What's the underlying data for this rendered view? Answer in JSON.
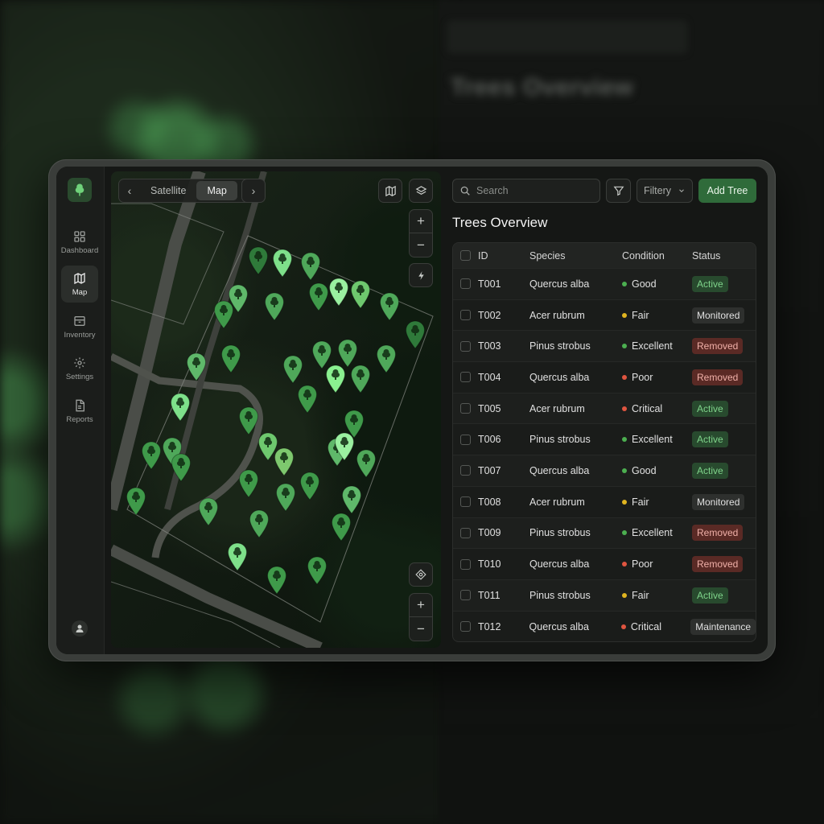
{
  "colors": {
    "accent": "#2f6b3a",
    "good": "#4caf50",
    "fair": "#e0b420",
    "poor": "#e05540",
    "badge_active_bg": "#284a2e",
    "badge_active_fg": "#7ed38a",
    "badge_removed_bg": "#5a2a25",
    "badge_removed_fg": "#f0b0a8",
    "badge_neutral_bg": "#2e302e",
    "badge_neutral_fg": "#e0e0e0"
  },
  "background": {
    "title": "Trees Overview"
  },
  "sidebar": {
    "logo_icon": "tree-icon",
    "items": [
      {
        "label": "Dashboard",
        "icon": "grid-icon",
        "active": false
      },
      {
        "label": "Map",
        "icon": "map-icon",
        "active": true
      },
      {
        "label": "Inventory",
        "icon": "box-icon",
        "active": false
      },
      {
        "label": "Settings",
        "icon": "gear-icon",
        "active": false
      },
      {
        "label": "Reports",
        "icon": "document-icon",
        "active": false
      }
    ],
    "user_icon": "user-icon"
  },
  "map": {
    "view_tabs": [
      "Satellite",
      "Map"
    ],
    "selected_view": "Map",
    "prev_label": "‹",
    "next_label": "›",
    "zoom_in": "+",
    "zoom_out": "−"
  },
  "panel": {
    "search_placeholder": "Search",
    "filter_label": "Filtery",
    "add_label": "Add Tree",
    "title": "Trees Overview",
    "columns": [
      "ID",
      "Species",
      "Condition",
      "Status"
    ],
    "rows": [
      {
        "id": "T001",
        "species": "Quercus alba",
        "condition": "Good",
        "status": "Active"
      },
      {
        "id": "T002",
        "species": "Acer rubrum",
        "condition": "Fair",
        "status": "Monitored"
      },
      {
        "id": "T003",
        "species": "Pinus strobus",
        "condition": "Excellent",
        "status": "Removed"
      },
      {
        "id": "T004",
        "species": "Quercus alba",
        "condition": "Poor",
        "status": "Removed"
      },
      {
        "id": "T005",
        "species": "Acer rubrum",
        "condition": "Critical",
        "status": "Active"
      },
      {
        "id": "T006",
        "species": "Pinus strobus",
        "condition": "Excellent",
        "status": "Active"
      },
      {
        "id": "T007",
        "species": "Quercus alba",
        "condition": "Good",
        "status": "Active"
      },
      {
        "id": "T008",
        "species": "Acer rubrum",
        "condition": "Fair",
        "status": "Monitored"
      },
      {
        "id": "T009",
        "species": "Pinus strobus",
        "condition": "Excellent",
        "status": "Removed"
      },
      {
        "id": "T010",
        "species": "Quercus alba",
        "condition": "Poor",
        "status": "Removed"
      },
      {
        "id": "T011",
        "species": "Pinus strobus",
        "condition": "Fair",
        "status": "Active"
      },
      {
        "id": "T012",
        "species": "Quercus alba",
        "condition": "Critical",
        "status": "Maintenance"
      }
    ]
  }
}
